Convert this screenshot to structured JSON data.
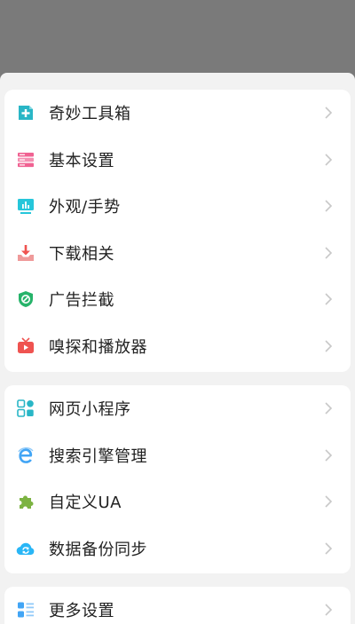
{
  "menu": {
    "group1": [
      {
        "label": "奇妙工具箱",
        "icon": "toolbox-plus-icon",
        "color": "#29b6c6"
      },
      {
        "label": "基本设置",
        "icon": "settings-list-icon",
        "color": "#f06292"
      },
      {
        "label": "外观/手势",
        "icon": "monitor-chart-icon",
        "color": "#26c6da"
      },
      {
        "label": "下载相关",
        "icon": "download-tray-icon",
        "color": "#ef5350"
      },
      {
        "label": "广告拦截",
        "icon": "shield-block-icon",
        "color": "#26b36a"
      },
      {
        "label": "嗅探和播放器",
        "icon": "tv-play-icon",
        "color": "#ef5350"
      }
    ],
    "group2": [
      {
        "label": "网页小程序",
        "icon": "grid-apps-icon",
        "color": "#29b6c6"
      },
      {
        "label": "搜索引擎管理",
        "icon": "browser-e-icon",
        "color": "#42a5f5"
      },
      {
        "label": "自定义UA",
        "icon": "puzzle-icon",
        "color": "#7cb342"
      },
      {
        "label": "数据备份同步",
        "icon": "cloud-sync-icon",
        "color": "#29b6f6"
      }
    ],
    "group3": [
      {
        "label": "更多设置",
        "icon": "more-list-icon",
        "color": "#42a5f5"
      }
    ]
  }
}
